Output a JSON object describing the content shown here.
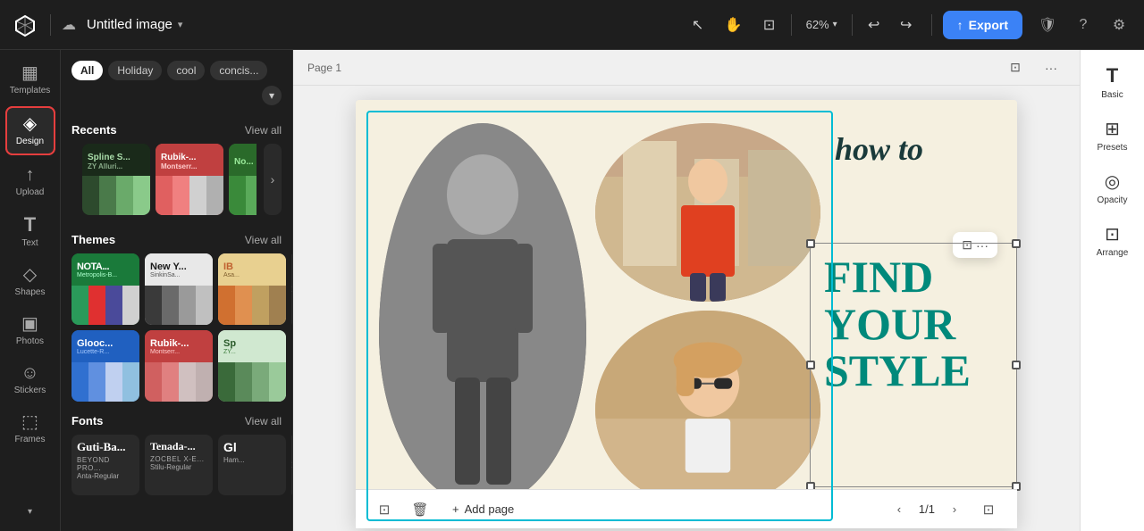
{
  "app": {
    "logo": "✕",
    "document_title": "Untitled image",
    "document_chevron": "▾",
    "cloud_icon": "☁"
  },
  "topbar": {
    "tools": [
      {
        "name": "select-tool",
        "icon": "↖",
        "label": "Select",
        "active": false
      },
      {
        "name": "hand-tool",
        "icon": "✋",
        "label": "Pan",
        "active": false
      },
      {
        "name": "frame-tool",
        "icon": "⊡",
        "label": "Frame",
        "active": false
      }
    ],
    "zoom": "62%",
    "zoom_chevron": "▾",
    "undo_icon": "↩",
    "redo_icon": "↪",
    "export_label": "Export",
    "export_icon": "↑",
    "shield_icon": "🛡",
    "question_icon": "?",
    "gear_icon": "⚙"
  },
  "left_sidebar": {
    "items": [
      {
        "name": "templates",
        "icon": "▦",
        "label": "Templates"
      },
      {
        "name": "design",
        "icon": "◈",
        "label": "Design",
        "active": true
      },
      {
        "name": "upload",
        "icon": "↑",
        "label": "Upload"
      },
      {
        "name": "text",
        "icon": "T",
        "label": "Text"
      },
      {
        "name": "shapes",
        "icon": "◇",
        "label": "Shapes"
      },
      {
        "name": "photos",
        "icon": "▣",
        "label": "Photos"
      },
      {
        "name": "stickers",
        "icon": "☺",
        "label": "Stickers"
      },
      {
        "name": "frames",
        "icon": "⬚",
        "label": "Frames"
      }
    ],
    "more_icon": "▾"
  },
  "panel": {
    "filter_tabs": [
      {
        "label": "All",
        "active": true
      },
      {
        "label": "Holiday",
        "active": false
      },
      {
        "label": "cool",
        "active": false
      },
      {
        "label": "concis...",
        "active": false
      }
    ],
    "filter_dropdown": "▾",
    "recents": {
      "title": "Recents",
      "view_all": "View all",
      "items": [
        {
          "name": "spline-alluri",
          "title_text": "Spline S...",
          "subtitle_text": "ZY Alluri...",
          "bg_top": "#1a2a1a",
          "swatches": [
            "#2d4a2d",
            "#4a7a4a",
            "#6aaa6a",
            "#8aca8a"
          ]
        },
        {
          "name": "rubik-montserrat",
          "title_text": "Rubik-...",
          "subtitle_text": "Montserr...",
          "bg_top": "#c04040",
          "swatches": [
            "#e06060",
            "#f08080",
            "#d0d0d0",
            "#b0b0b0"
          ]
        },
        {
          "name": "no-font",
          "title_text": "No...",
          "subtitle_text": "",
          "bg_top": "#2a6a2a",
          "swatches": [
            "#3a8a3a",
            "#5aaa5a",
            "#7aca7a",
            "#9aea9a"
          ]
        }
      ],
      "nav_icon": "›"
    },
    "themes": {
      "title": "Themes",
      "view_all": "View all",
      "items": [
        {
          "name": "nota-metropolis",
          "title_text": "NOTA...",
          "subtitle_text": "Metropolis-B...",
          "bg_top": "#1a7a3a",
          "title_color": "#ffffff",
          "swatches": [
            "#2a9a5a",
            "#e03030",
            "#4a4a9a",
            "#d0d0d0"
          ]
        },
        {
          "name": "newyork-sinkin",
          "title_text": "New Y...",
          "subtitle_text": "SinkinSa...",
          "bg_top": "#e8e8e8",
          "title_color": "#1a1a1a",
          "swatches": [
            "#3a3a3a",
            "#6a6a6a",
            "#9a9a9a",
            "#c0c0c0"
          ]
        },
        {
          "name": "ib-asa",
          "title_text": "IB",
          "subtitle_text": "Asa...",
          "bg_top": "#e8d090",
          "title_color": "#c06030",
          "swatches": [
            "#d07030",
            "#e09050",
            "#c0a060",
            "#a08050"
          ]
        }
      ],
      "nav_icon": "›",
      "row2_items": [
        {
          "name": "glooc-lucette",
          "title_text": "Glooc...",
          "subtitle_text": "Lucette-R...",
          "bg_top": "#2060c0",
          "title_color": "#ffffff",
          "swatches": [
            "#3070d0",
            "#6090e0",
            "#c0d0f0",
            "#90c0e0"
          ]
        },
        {
          "name": "rubik-montserrat2",
          "title_text": "Rubik-...",
          "subtitle_text": "Montserr...",
          "bg_top": "#c04040",
          "title_color": "#ffffff",
          "swatches": [
            "#d06060",
            "#e08080",
            "#d0c0c0",
            "#c0b0b0"
          ]
        },
        {
          "name": "sp-zy",
          "title_text": "Sp",
          "subtitle_text": "ZY...",
          "bg_top": "#d0e8d0",
          "title_color": "#2a5a2a",
          "swatches": [
            "#3a6a3a",
            "#5a8a5a",
            "#7aaa7a",
            "#9aca9a"
          ]
        }
      ]
    },
    "fonts": {
      "title": "Fonts",
      "view_all": "View all",
      "items": [
        {
          "name": "guti-beyond",
          "main": "Guti-Ba...",
          "sub1": "BEYOND PRO...",
          "sub2": "Anta-Regular"
        },
        {
          "name": "tenada-zocbel",
          "main": "Tenada-...",
          "sub1": "Zocbel X-E...",
          "sub2": "Stilu-Regular"
        },
        {
          "name": "gl-ham",
          "main": "Gl",
          "sub1": "",
          "sub2": "Ham..."
        }
      ],
      "nav_icon": "›"
    }
  },
  "canvas": {
    "page_label": "Page 1",
    "page_icon": "⊡",
    "more_icon": "···",
    "design_text_how_to": "how to",
    "design_text_find": "FIND",
    "design_text_your": "YOUR",
    "design_text_style": "STYLE",
    "context_menu": {
      "image_icon": "⊡",
      "dots": "···"
    }
  },
  "bottom_bar": {
    "frame_icon": "⊡",
    "trash_icon": "🗑",
    "add_page_icon": "+",
    "add_page_label": "Add page",
    "page_current": "1/1",
    "fullscreen_icon": "⊡",
    "nav_prev": "‹",
    "nav_next": "›"
  },
  "right_sidebar": {
    "items": [
      {
        "name": "basic",
        "icon": "T",
        "label": "Basic"
      },
      {
        "name": "presets",
        "icon": "⊞",
        "label": "Presets"
      },
      {
        "name": "opacity",
        "icon": "◎",
        "label": "Opacity"
      },
      {
        "name": "arrange",
        "icon": "⊡",
        "label": "Arrange"
      }
    ]
  }
}
